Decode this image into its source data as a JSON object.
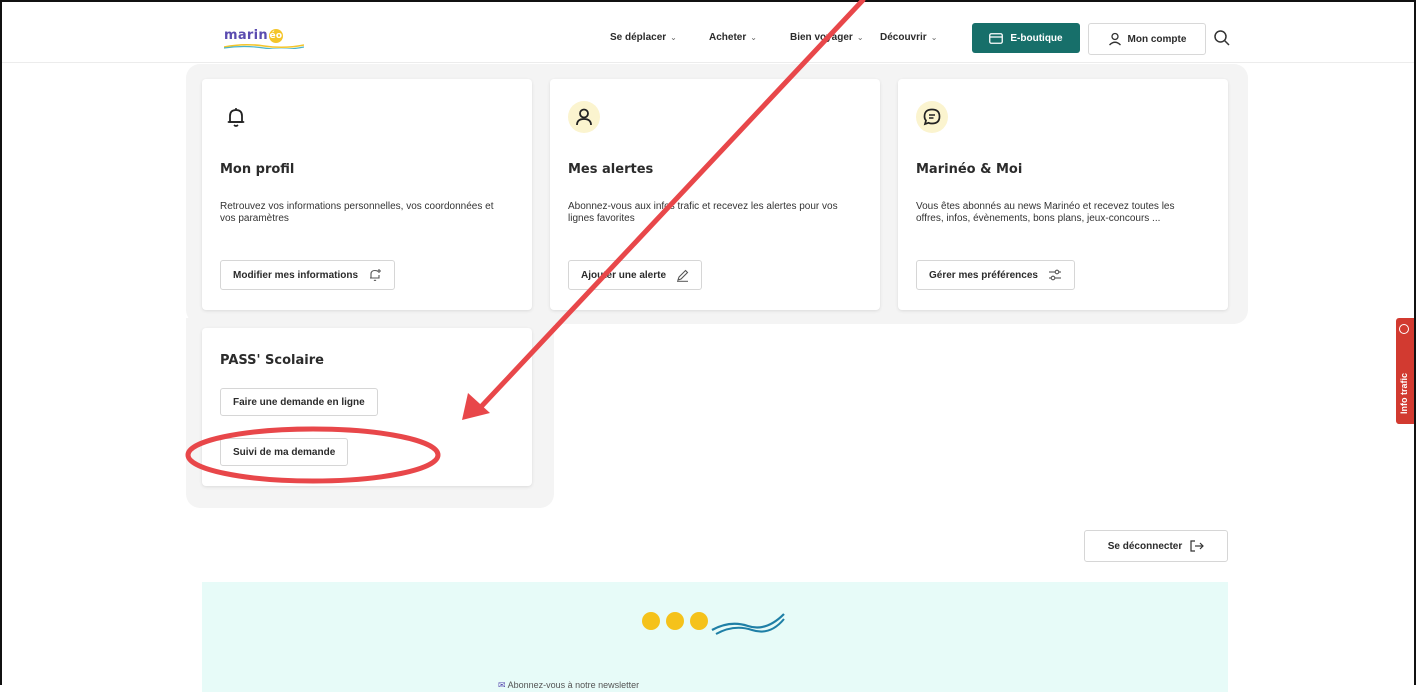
{
  "header": {
    "logo_text": "marin",
    "logo_o": "éo",
    "nav": [
      {
        "label": "Se déplacer"
      },
      {
        "label": "Acheter"
      },
      {
        "label": "Bien voyager"
      },
      {
        "label": "Découvrir"
      }
    ],
    "eboutique_label": "E-boutique",
    "account_label": "Mon compte"
  },
  "cards": {
    "profil": {
      "title": "Mon profil",
      "desc": "Retrouvez vos informations personnelles, vos coordonnées et vos paramètres",
      "button": "Modifier mes informations"
    },
    "alertes": {
      "title": "Mes alertes",
      "desc": "Abonnez-vous aux infos trafic et recevez les alertes pour vos lignes favorites",
      "button": "Ajouter une alerte"
    },
    "moi": {
      "title": "Marinéo & Moi",
      "desc": "Vous êtes abonnés au news Marinéo et recevez toutes les offres, infos, évènements, bons plans, jeux-concours ...",
      "button": "Gérer mes préférences"
    },
    "pass": {
      "title": "PASS' Scolaire",
      "button_online": "Faire une demande en ligne",
      "button_suivi": "Suivi de ma demande"
    }
  },
  "logout_label": "Se déconnecter",
  "newsletter_text": "Abonnez-vous à notre newsletter",
  "info_trafic_label": "Info trafic",
  "colors": {
    "brand_teal": "#176f6a",
    "accent_yellow": "#f5c21b",
    "annotation_red": "#e8474a",
    "info_red": "#d23a30"
  }
}
